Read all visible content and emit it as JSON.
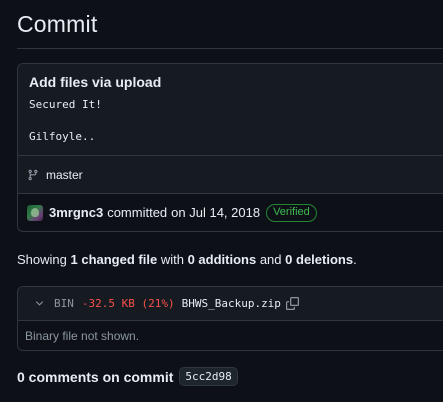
{
  "page": {
    "title": "Commit"
  },
  "commit": {
    "title": "Add files via upload",
    "description": "Secured It!\n\nGilfoyle..",
    "branch": "master",
    "author": "3mrgnc3",
    "verb": "committed",
    "date": "on Jul 14, 2018",
    "badge": "Verified"
  },
  "summary": {
    "prefix": "Showing",
    "changed": "1 changed file",
    "with": "with",
    "additions": "0 additions",
    "and": "and",
    "deletions": "0 deletions",
    "end": "."
  },
  "file": {
    "type": "BIN",
    "delta": "-32.5 KB (21%)",
    "name": "BHWS_Backup.zip",
    "body": "Binary file not shown."
  },
  "comments": {
    "label": "0 comments on commit",
    "sha": "5cc2d98"
  },
  "colors": {
    "background": "#0d1117",
    "verified": "#3fb950",
    "deletion": "#f85149"
  },
  "icons": [
    "git-branch-icon",
    "chevron-down-icon",
    "copy-icon"
  ]
}
